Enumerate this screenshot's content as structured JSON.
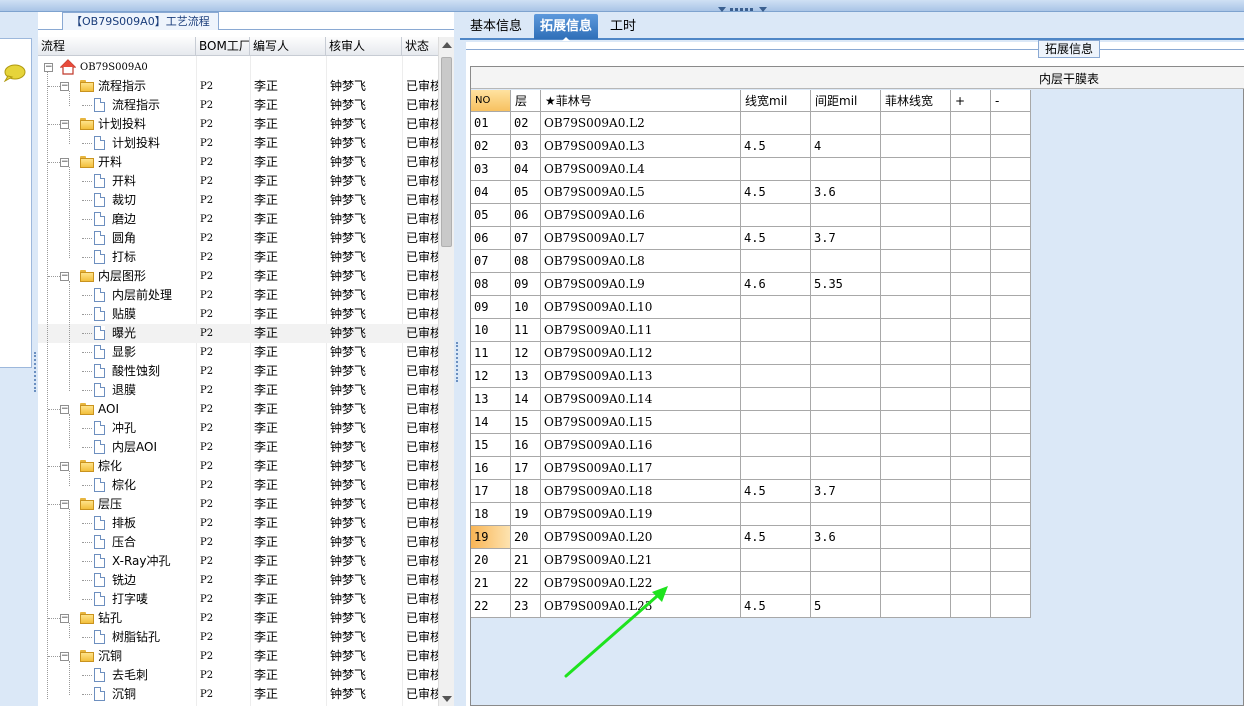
{
  "left_panel": {
    "tab_title": "【OB79S009A0】工艺流程",
    "columns": [
      "流程",
      "BOM工厂",
      "编写人",
      "核审人",
      "状态"
    ],
    "rows": [
      {
        "level": 0,
        "type": "root",
        "label": "OB79S009A0",
        "bom": "",
        "writer": "",
        "reviewer": "",
        "status": ""
      },
      {
        "level": 1,
        "type": "folder",
        "label": "流程指示",
        "bom": "P2",
        "writer": "李正",
        "reviewer": "钟梦飞",
        "status": "已审核"
      },
      {
        "level": 2,
        "type": "doc",
        "label": "流程指示",
        "bom": "P2",
        "writer": "李正",
        "reviewer": "钟梦飞",
        "status": "已审核"
      },
      {
        "level": 1,
        "type": "folder",
        "label": "计划投料",
        "bom": "P2",
        "writer": "李正",
        "reviewer": "钟梦飞",
        "status": "已审核"
      },
      {
        "level": 2,
        "type": "doc",
        "label": "计划投料",
        "bom": "P2",
        "writer": "李正",
        "reviewer": "钟梦飞",
        "status": "已审核"
      },
      {
        "level": 1,
        "type": "folder",
        "label": "开料",
        "bom": "P2",
        "writer": "李正",
        "reviewer": "钟梦飞",
        "status": "已审核"
      },
      {
        "level": 2,
        "type": "doc",
        "label": "开料",
        "bom": "P2",
        "writer": "李正",
        "reviewer": "钟梦飞",
        "status": "已审核"
      },
      {
        "level": 2,
        "type": "doc",
        "label": "裁切",
        "bom": "P2",
        "writer": "李正",
        "reviewer": "钟梦飞",
        "status": "已审核"
      },
      {
        "level": 2,
        "type": "doc",
        "label": "磨边",
        "bom": "P2",
        "writer": "李正",
        "reviewer": "钟梦飞",
        "status": "已审核"
      },
      {
        "level": 2,
        "type": "doc",
        "label": "圆角",
        "bom": "P2",
        "writer": "李正",
        "reviewer": "钟梦飞",
        "status": "已审核"
      },
      {
        "level": 2,
        "type": "doc",
        "label": "打标",
        "bom": "P2",
        "writer": "李正",
        "reviewer": "钟梦飞",
        "status": "已审核"
      },
      {
        "level": 1,
        "type": "folder",
        "label": "内层图形",
        "bom": "P2",
        "writer": "李正",
        "reviewer": "钟梦飞",
        "status": "已审核"
      },
      {
        "level": 2,
        "type": "doc",
        "label": "内层前处理",
        "bom": "P2",
        "writer": "李正",
        "reviewer": "钟梦飞",
        "status": "已审核"
      },
      {
        "level": 2,
        "type": "doc",
        "label": "贴膜",
        "bom": "P2",
        "writer": "李正",
        "reviewer": "钟梦飞",
        "status": "已审核"
      },
      {
        "level": 2,
        "type": "doc",
        "label": "曝光",
        "bom": "P2",
        "writer": "李正",
        "reviewer": "钟梦飞",
        "status": "已审核",
        "selected": true
      },
      {
        "level": 2,
        "type": "doc",
        "label": "显影",
        "bom": "P2",
        "writer": "李正",
        "reviewer": "钟梦飞",
        "status": "已审核"
      },
      {
        "level": 2,
        "type": "doc",
        "label": "酸性蚀刻",
        "bom": "P2",
        "writer": "李正",
        "reviewer": "钟梦飞",
        "status": "已审核"
      },
      {
        "level": 2,
        "type": "doc",
        "label": "退膜",
        "bom": "P2",
        "writer": "李正",
        "reviewer": "钟梦飞",
        "status": "已审核"
      },
      {
        "level": 1,
        "type": "folder",
        "label": "AOI",
        "bom": "P2",
        "writer": "李正",
        "reviewer": "钟梦飞",
        "status": "已审核"
      },
      {
        "level": 2,
        "type": "doc",
        "label": "冲孔",
        "bom": "P2",
        "writer": "李正",
        "reviewer": "钟梦飞",
        "status": "已审核"
      },
      {
        "level": 2,
        "type": "doc",
        "label": "内层AOI",
        "bom": "P2",
        "writer": "李正",
        "reviewer": "钟梦飞",
        "status": "已审核"
      },
      {
        "level": 1,
        "type": "folder",
        "label": "棕化",
        "bom": "P2",
        "writer": "李正",
        "reviewer": "钟梦飞",
        "status": "已审核"
      },
      {
        "level": 2,
        "type": "doc",
        "label": "棕化",
        "bom": "P2",
        "writer": "李正",
        "reviewer": "钟梦飞",
        "status": "已审核"
      },
      {
        "level": 1,
        "type": "folder",
        "label": "层压",
        "bom": "P2",
        "writer": "李正",
        "reviewer": "钟梦飞",
        "status": "已审核"
      },
      {
        "level": 2,
        "type": "doc",
        "label": "排板",
        "bom": "P2",
        "writer": "李正",
        "reviewer": "钟梦飞",
        "status": "已审核"
      },
      {
        "level": 2,
        "type": "doc",
        "label": "压合",
        "bom": "P2",
        "writer": "李正",
        "reviewer": "钟梦飞",
        "status": "已审核"
      },
      {
        "level": 2,
        "type": "doc",
        "label": "X-Ray冲孔",
        "bom": "P2",
        "writer": "李正",
        "reviewer": "钟梦飞",
        "status": "已审核"
      },
      {
        "level": 2,
        "type": "doc",
        "label": "铣边",
        "bom": "P2",
        "writer": "李正",
        "reviewer": "钟梦飞",
        "status": "已审核"
      },
      {
        "level": 2,
        "type": "doc",
        "label": "打字唛",
        "bom": "P2",
        "writer": "李正",
        "reviewer": "钟梦飞",
        "status": "已审核"
      },
      {
        "level": 1,
        "type": "folder",
        "label": "钻孔",
        "bom": "P2",
        "writer": "李正",
        "reviewer": "钟梦飞",
        "status": "已审核"
      },
      {
        "level": 2,
        "type": "doc",
        "label": "树脂钻孔",
        "bom": "P2",
        "writer": "李正",
        "reviewer": "钟梦飞",
        "status": "已审核"
      },
      {
        "level": 1,
        "type": "folder",
        "label": "沉铜",
        "bom": "P2",
        "writer": "李正",
        "reviewer": "钟梦飞",
        "status": "已审核"
      },
      {
        "level": 2,
        "type": "doc",
        "label": "去毛刺",
        "bom": "P2",
        "writer": "李正",
        "reviewer": "钟梦飞",
        "status": "已审核"
      },
      {
        "level": 2,
        "type": "doc",
        "label": "沉铜",
        "bom": "P2",
        "writer": "李正",
        "reviewer": "钟梦飞",
        "status": "已审核"
      }
    ]
  },
  "tabs": [
    {
      "label": "基本信息",
      "active": false
    },
    {
      "label": "拓展信息",
      "active": true
    },
    {
      "label": "工时",
      "active": false
    }
  ],
  "group_title": "拓展信息",
  "table": {
    "caption": "内层干膜表",
    "columns": [
      "NO",
      "层",
      "★菲林号",
      "线宽mil",
      "间距mil",
      "菲林线宽",
      "+",
      "-"
    ],
    "highlight_row": "19",
    "rows": [
      [
        "01",
        "02",
        "OB79S009A0.L2",
        "",
        ""
      ],
      [
        "02",
        "03",
        "OB79S009A0.L3",
        "4.5",
        "4"
      ],
      [
        "03",
        "04",
        "OB79S009A0.L4",
        "",
        ""
      ],
      [
        "04",
        "05",
        "OB79S009A0.L5",
        "4.5",
        "3.6"
      ],
      [
        "05",
        "06",
        "OB79S009A0.L6",
        "",
        ""
      ],
      [
        "06",
        "07",
        "OB79S009A0.L7",
        "4.5",
        "3.7"
      ],
      [
        "07",
        "08",
        "OB79S009A0.L8",
        "",
        ""
      ],
      [
        "08",
        "09",
        "OB79S009A0.L9",
        "4.6",
        "5.35"
      ],
      [
        "09",
        "10",
        "OB79S009A0.L10",
        "",
        ""
      ],
      [
        "10",
        "11",
        "OB79S009A0.L11",
        "",
        ""
      ],
      [
        "11",
        "12",
        "OB79S009A0.L12",
        "",
        ""
      ],
      [
        "12",
        "13",
        "OB79S009A0.L13",
        "",
        ""
      ],
      [
        "13",
        "14",
        "OB79S009A0.L14",
        "",
        ""
      ],
      [
        "14",
        "15",
        "OB79S009A0.L15",
        "",
        ""
      ],
      [
        "15",
        "16",
        "OB79S009A0.L16",
        "",
        ""
      ],
      [
        "16",
        "17",
        "OB79S009A0.L17",
        "",
        ""
      ],
      [
        "17",
        "18",
        "OB79S009A0.L18",
        "4.5",
        "3.7"
      ],
      [
        "18",
        "19",
        "OB79S009A0.L19",
        "",
        ""
      ],
      [
        "19",
        "20",
        "OB79S009A0.L20",
        "4.5",
        "3.6"
      ],
      [
        "20",
        "21",
        "OB79S009A0.L21",
        "",
        ""
      ],
      [
        "21",
        "22",
        "OB79S009A0.L22",
        "",
        ""
      ],
      [
        "22",
        "23",
        "OB79S009A0.L23",
        "4.5",
        "5"
      ]
    ]
  },
  "colors": {
    "accent": "#2f6fb8",
    "panel_bg": "#dbe8f7",
    "annotation_arrow": "#1ee31e",
    "highlight": "#f9b555"
  }
}
